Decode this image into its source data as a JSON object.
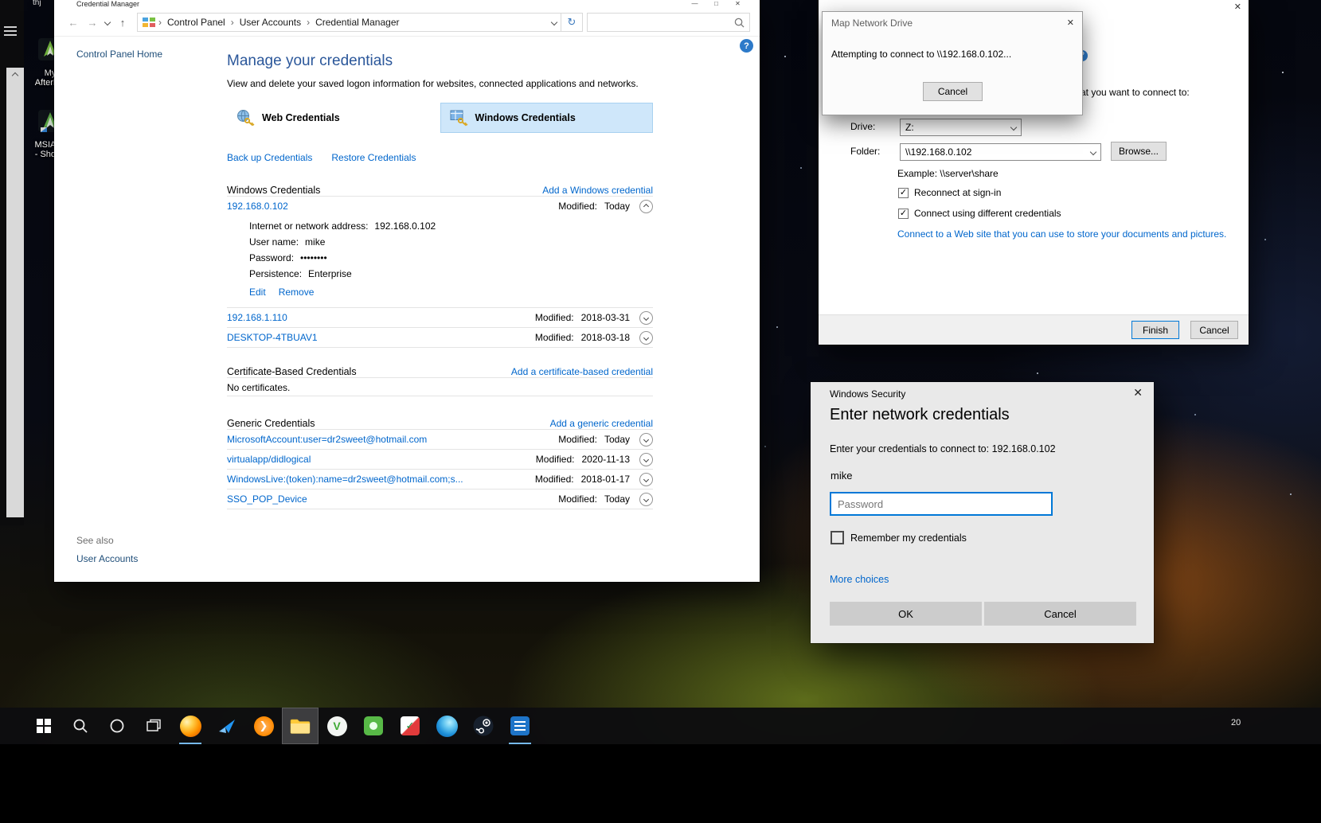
{
  "icons": {
    "minimize": "—",
    "maximize": "□",
    "close": "✕",
    "back": "←",
    "forward": "→",
    "up": "↑",
    "refresh": "↻",
    "crumb_sep": "›",
    "help": "?",
    "check": "✓"
  },
  "desktop": {
    "top_left_label": "thj",
    "icons": [
      {
        "label": "My\nAfterb..."
      },
      {
        "label": "MSIAf...\n- Shor..."
      }
    ],
    "taskbar": {
      "clock": "20"
    }
  },
  "credman": {
    "window_title": "Credential Manager",
    "breadcrumb": [
      "Control Panel",
      "User Accounts",
      "Credential Manager"
    ],
    "sidebar_home": "Control Panel Home",
    "heading": "Manage your credentials",
    "description": "View and delete your saved logon information for websites, connected applications and networks.",
    "tabs": {
      "web": "Web Credentials",
      "windows": "Windows Credentials"
    },
    "backup_link": "Back up Credentials",
    "restore_link": "Restore Credentials",
    "sections": {
      "windows": {
        "title": "Windows Credentials",
        "add_link": "Add a Windows credential"
      },
      "cert": {
        "title": "Certificate-Based Credentials",
        "add_link": "Add a certificate-based credential",
        "empty": "No certificates."
      },
      "generic": {
        "title": "Generic Credentials",
        "add_link": "Add a generic credential"
      }
    },
    "win_rows": [
      {
        "name": "192.168.0.102",
        "modified_label": "Modified:",
        "modified_value": "Today"
      },
      {
        "name": "192.168.1.110",
        "modified_label": "Modified:",
        "modified_value": "2018-03-31"
      },
      {
        "name": "DESKTOP-4TBUAV1",
        "modified_label": "Modified:",
        "modified_value": "2018-03-18"
      }
    ],
    "detail": {
      "fields": [
        {
          "label": "Internet or network address:",
          "value": "192.168.0.102"
        },
        {
          "label": "User name:",
          "value": "mike"
        },
        {
          "label": "Password:",
          "value": "••••••••"
        },
        {
          "label": "Persistence:",
          "value": "Enterprise"
        }
      ],
      "edit_link": "Edit",
      "remove_link": "Remove"
    },
    "generic_rows": [
      {
        "name": "MicrosoftAccount:user=dr2sweet@hotmail.com",
        "modified_label": "Modified:",
        "modified_value": "Today"
      },
      {
        "name": "virtualapp/didlogical",
        "modified_label": "Modified:",
        "modified_value": "2020-11-13"
      },
      {
        "name": "WindowsLive:(token):name=dr2sweet@hotmail.com;s...",
        "modified_label": "Modified:",
        "modified_value": "2018-01-17"
      },
      {
        "name": "SSO_POP_Device",
        "modified_label": "Modified:",
        "modified_value": "Today"
      }
    ],
    "see_also": "See also",
    "user_accounts_link": "User Accounts"
  },
  "map_wizard": {
    "instruction_fragment": "at you want to connect to:",
    "drive_label": "Drive:",
    "drive_value": "Z:",
    "folder_label": "Folder:",
    "folder_value": "\\\\192.168.0.102",
    "browse_button": "Browse...",
    "example": "Example: \\\\server\\share",
    "reconnect_label": "Reconnect at sign-in",
    "different_creds_label": "Connect using different credentials",
    "web_link": "Connect to a Web site that you can use to store your documents and pictures.",
    "finish_button": "Finish",
    "cancel_button": "Cancel"
  },
  "map_progress": {
    "title": "Map Network Drive",
    "message": "Attempting to connect to \\\\192.168.0.102...",
    "cancel_button": "Cancel"
  },
  "win_security": {
    "title": "Windows Security",
    "heading": "Enter network credentials",
    "subtext": "Enter your credentials to connect to: 192.168.0.102",
    "username": "mike",
    "password_placeholder": "Password",
    "remember_label": "Remember my credentials",
    "more_choices_link": "More choices",
    "ok_button": "OK",
    "cancel_button": "Cancel"
  }
}
